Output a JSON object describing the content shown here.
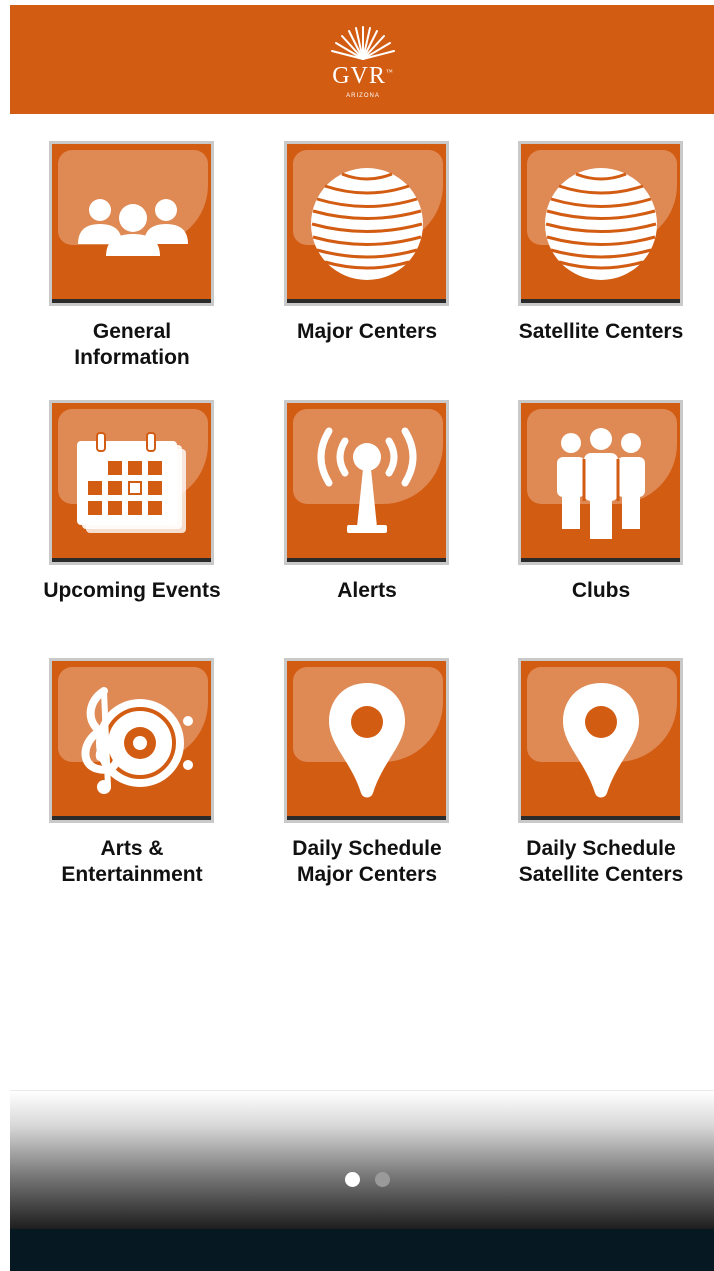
{
  "header": {
    "logo_text": "GVR",
    "logo_trademark": "™",
    "logo_subtext": "ARIZONA",
    "background_color": "#d35c13"
  },
  "tiles": [
    {
      "label": "General\nInformation",
      "icon": "people-group-icon"
    },
    {
      "label": "Major Centers",
      "icon": "globe-icon"
    },
    {
      "label": "Satellite Centers",
      "icon": "globe-icon"
    },
    {
      "label": "Upcoming Events",
      "icon": "calendar-icon"
    },
    {
      "label": "Alerts",
      "icon": "broadcast-tower-icon"
    },
    {
      "label": "Clubs",
      "icon": "people-standing-icon"
    },
    {
      "label": "Arts &\nEntertainment",
      "icon": "music-speaker-icon"
    },
    {
      "label": "Daily Schedule\nMajor Centers",
      "icon": "map-pin-icon"
    },
    {
      "label": "Daily Schedule\nSatellite Centers",
      "icon": "map-pin-icon"
    }
  ],
  "pager": {
    "total": 2,
    "active": 1
  },
  "colors": {
    "accent": "#d35c13",
    "navbar": "#061821"
  }
}
